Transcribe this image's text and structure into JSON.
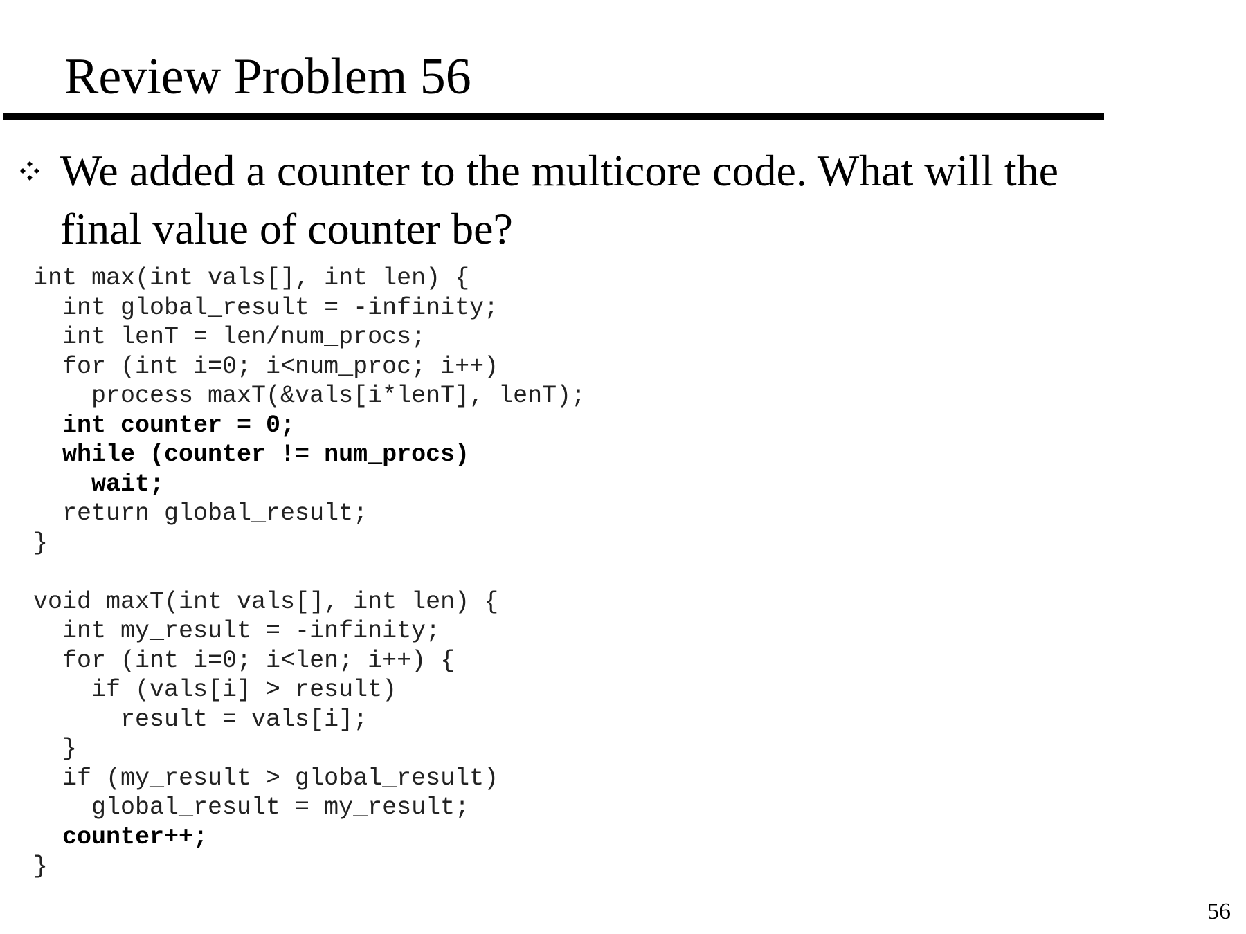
{
  "slide": {
    "title": "Review Problem 56",
    "page_number": "56"
  },
  "bullet": {
    "icon": "diamond-bullet-icon",
    "lines": [
      "We added a counter to the multicore code.  What will the",
      "final value of counter be?"
    ]
  },
  "code": {
    "lines": [
      {
        "text": "int max(int vals[], int len) {",
        "bold": false
      },
      {
        "text": "  int global_result = -infinity;",
        "bold": false
      },
      {
        "text": "  int lenT = len/num_procs;",
        "bold": false
      },
      {
        "text": "  for (int i=0; i<num_proc; i++)",
        "bold": false
      },
      {
        "text": "    process maxT(&vals[i*lenT], lenT);",
        "bold": false
      },
      {
        "text": "  int counter = 0;",
        "bold": true
      },
      {
        "text": "  while (counter != num_procs)",
        "bold": true
      },
      {
        "text": "    wait;",
        "bold": true
      },
      {
        "text": "  return global_result;",
        "bold": false
      },
      {
        "text": "}",
        "bold": false
      },
      {
        "text": "",
        "bold": false
      },
      {
        "text": "void maxT(int vals[], int len) {",
        "bold": false
      },
      {
        "text": "  int my_result = -infinity;",
        "bold": false
      },
      {
        "text": "  for (int i=0; i<len; i++) {",
        "bold": false
      },
      {
        "text": "    if (vals[i] > result)",
        "bold": false
      },
      {
        "text": "      result = vals[i];",
        "bold": false
      },
      {
        "text": "  }",
        "bold": false
      },
      {
        "text": "  if (my_result > global_result)",
        "bold": false
      },
      {
        "text": "    global_result = my_result;",
        "bold": false
      },
      {
        "text": "  counter++;",
        "bold": true
      },
      {
        "text": "}",
        "bold": false
      }
    ]
  }
}
